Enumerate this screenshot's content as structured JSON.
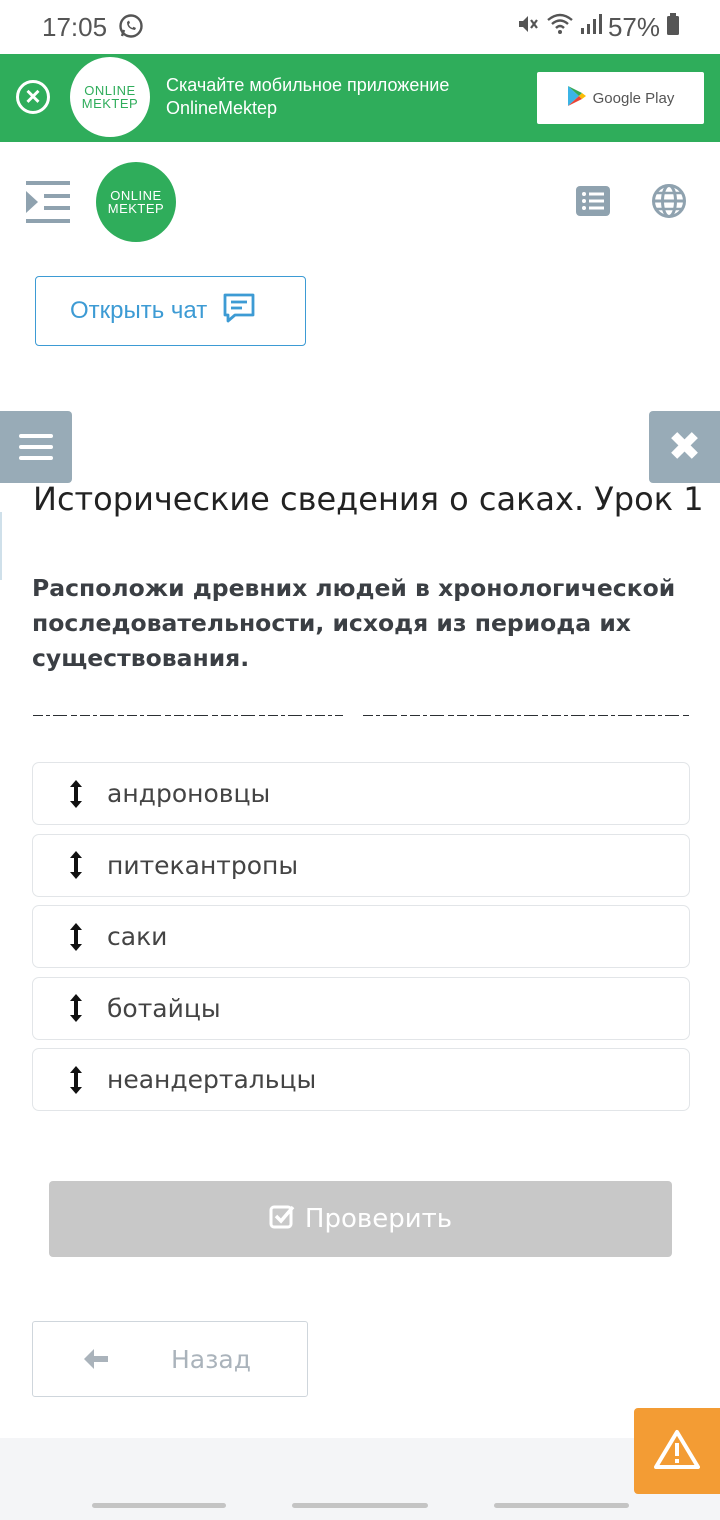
{
  "status_bar": {
    "time": "17:05",
    "battery": "57%",
    "icons": [
      "whatsapp-icon",
      "mute-icon",
      "wifi-icon",
      "signal-icon",
      "battery-icon"
    ]
  },
  "promo": {
    "logo_line1": "ONLINE",
    "logo_line2": "MEKTEP",
    "text_line1": "Скачайте мобильное приложение",
    "text_line2": "OnlineMektep",
    "store_label": "Google Play",
    "brand_color": "#2fad5b"
  },
  "header": {
    "logo_line1": "ONLINE",
    "logo_line2": "MEKTEP",
    "open_chat_label": "Открыть чат"
  },
  "lesson": {
    "title": "Исторические сведения о саках. Урок 1",
    "task": "Расположи древних людей в хронологической последовательности, исходя из периода их существования."
  },
  "sort_items": [
    "андроновцы",
    "питекантропы",
    "саки",
    "ботайцы",
    "неандертальцы"
  ],
  "actions": {
    "check_label": "Проверить",
    "back_label": "Назад"
  },
  "colors": {
    "accent_blue": "#3d9bd4",
    "side_tab": "#98abb7",
    "warning": "#f39c34",
    "disabled_button": "#c8c8c8"
  }
}
